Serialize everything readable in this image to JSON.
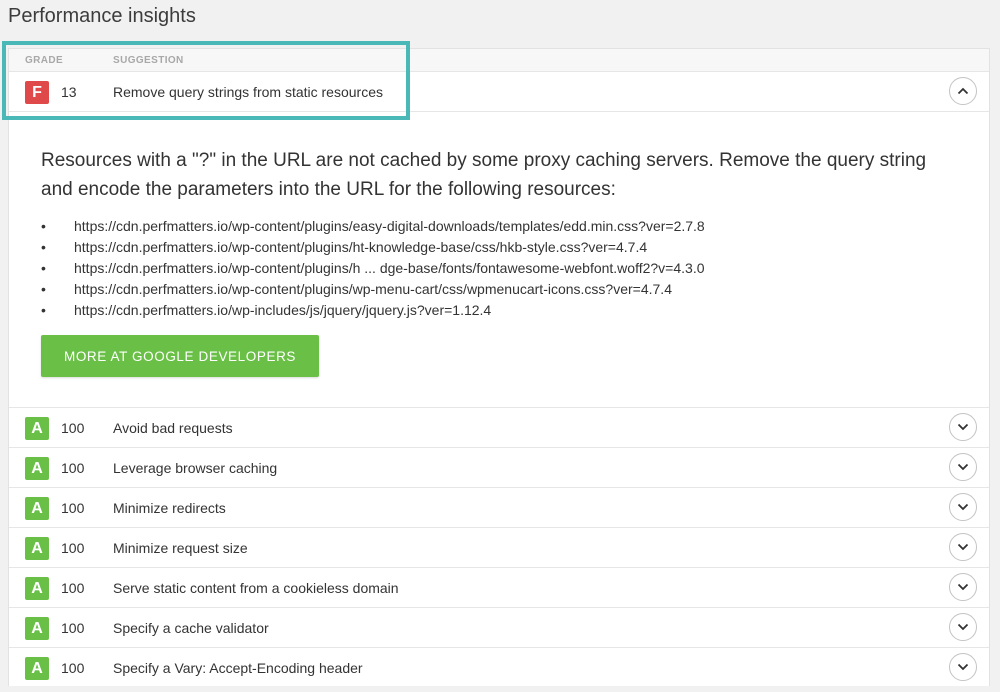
{
  "page": {
    "title": "Performance insights"
  },
  "table": {
    "col_grade": "GRADE",
    "col_suggestion": "SUGGESTION"
  },
  "expanded": {
    "grade": "F",
    "score": "13",
    "suggestion": "Remove query strings from static resources",
    "description": "Resources with a \"?\" in the URL are not cached by some proxy caching servers. Remove the query string and encode the parameters into the URL for the following resources:",
    "resources": [
      "https://cdn.perfmatters.io/wp-content/plugins/easy-digital-downloads/templates/edd.min.css?ver=2.7.8",
      "https://cdn.perfmatters.io/wp-content/plugins/ht-knowledge-base/css/hkb-style.css?ver=4.7.4",
      "https://cdn.perfmatters.io/wp-content/plugins/h ... dge-base/fonts/fontawesome-webfont.woff2?v=4.3.0",
      "https://cdn.perfmatters.io/wp-content/plugins/wp-menu-cart/css/wpmenucart-icons.css?ver=4.7.4",
      "https://cdn.perfmatters.io/wp-includes/js/jquery/jquery.js?ver=1.12.4"
    ],
    "button_label": "MORE AT GOOGLE DEVELOPERS"
  },
  "rows": [
    {
      "grade": "A",
      "score": "100",
      "suggestion": "Avoid bad requests"
    },
    {
      "grade": "A",
      "score": "100",
      "suggestion": "Leverage browser caching"
    },
    {
      "grade": "A",
      "score": "100",
      "suggestion": "Minimize redirects"
    },
    {
      "grade": "A",
      "score": "100",
      "suggestion": "Minimize request size"
    },
    {
      "grade": "A",
      "score": "100",
      "suggestion": "Serve static content from a cookieless domain"
    },
    {
      "grade": "A",
      "score": "100",
      "suggestion": "Specify a cache validator"
    },
    {
      "grade": "A",
      "score": "100",
      "suggestion": "Specify a Vary: Accept-Encoding header"
    }
  ],
  "colors": {
    "grade_f": "#e04949",
    "grade_a": "#6ac046",
    "highlight": "#4bb8b8",
    "button": "#6ac046"
  },
  "icons": {
    "collapse": "chevron-up-icon",
    "expand": "chevron-down-icon"
  }
}
